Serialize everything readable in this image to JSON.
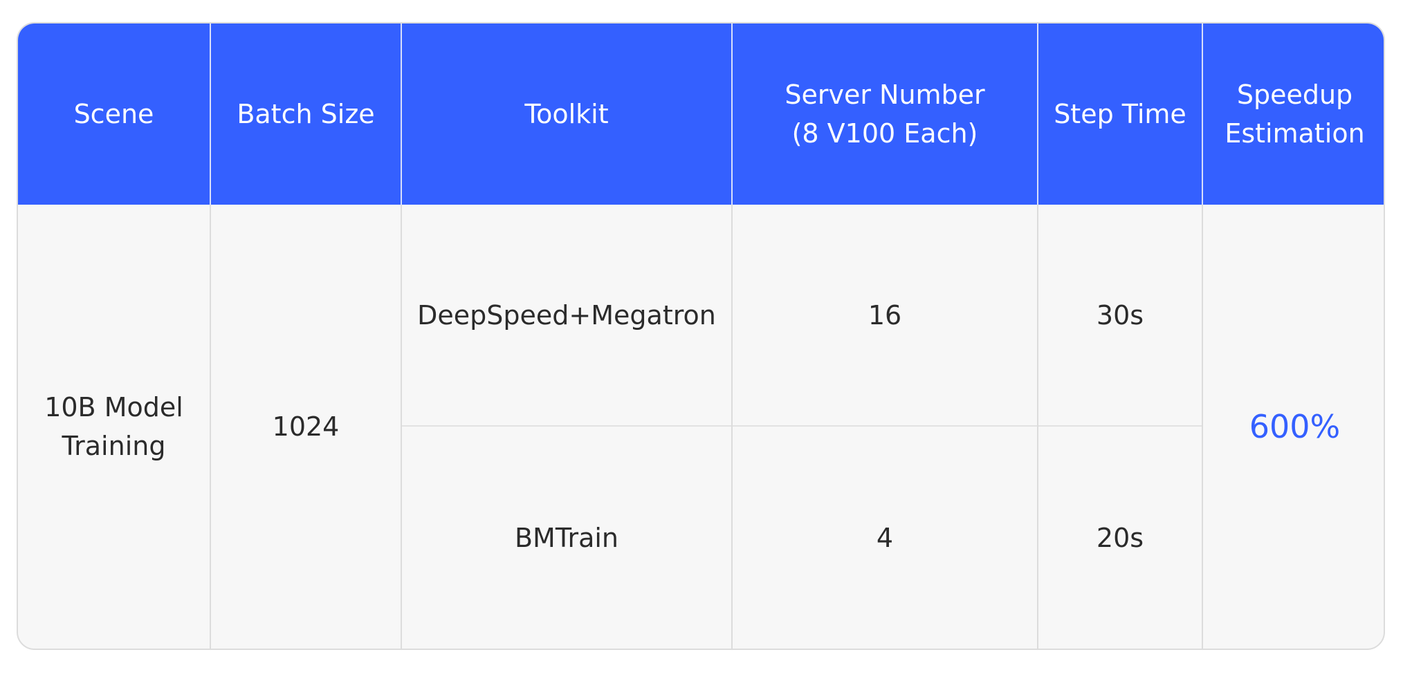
{
  "table": {
    "headers": [
      "Scene",
      "Batch Size",
      "Toolkit",
      "Server Number\n(8 V100 Each)",
      "Step Time",
      "Speedup\nEstimation"
    ],
    "scene": "10B Model\nTraining",
    "batch_size": "1024",
    "rows": [
      {
        "toolkit": "DeepSpeed+Megatron",
        "server_number": "16",
        "step_time": "30s"
      },
      {
        "toolkit": "BMTrain",
        "server_number": "4",
        "step_time": "20s"
      }
    ],
    "speedup": "600%"
  },
  "colors": {
    "header_bg": "#3460ff",
    "header_text": "#ffffff",
    "body_bg": "#f7f7f7",
    "accent_text": "#3460ff"
  }
}
